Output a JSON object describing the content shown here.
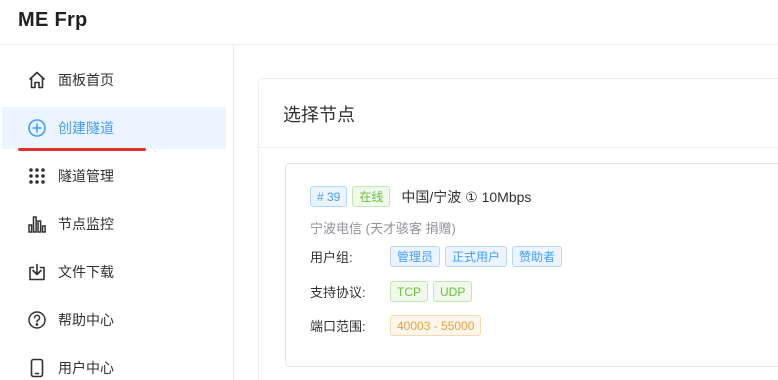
{
  "app": {
    "title": "ME Frp"
  },
  "sidebar": {
    "items": [
      {
        "label": "面板首页",
        "icon": "home-icon",
        "active": false
      },
      {
        "label": "创建隧道",
        "icon": "plus-circle-icon",
        "active": true
      },
      {
        "label": "隧道管理",
        "icon": "grid-dots-icon",
        "active": false
      },
      {
        "label": "节点监控",
        "icon": "bar-chart-icon",
        "active": false
      },
      {
        "label": "文件下载",
        "icon": "download-icon",
        "active": false
      },
      {
        "label": "帮助中心",
        "icon": "help-circle-icon",
        "active": false
      },
      {
        "label": "用户中心",
        "icon": "phone-icon",
        "active": false
      }
    ]
  },
  "main": {
    "title": "选择节点",
    "node": {
      "id_tag": "# 39",
      "status_tag": "在线",
      "name": "中国/宁波 ① 10Mbps",
      "description": "宁波电信 (天才骇客 捐赠)",
      "user_group_label": "用户组:",
      "user_groups": [
        "管理员",
        "正式用户",
        "赞助者"
      ],
      "protocol_label": "支持协议:",
      "protocols": [
        "TCP",
        "UDP"
      ],
      "port_label": "端口范围:",
      "port_range": "40003 - 55000"
    }
  },
  "colors": {
    "accent": "#409eff",
    "active_bg": "#ecf5ff",
    "success": "#67c23a",
    "warning": "#e6a23c",
    "underline": "#e0302c"
  }
}
